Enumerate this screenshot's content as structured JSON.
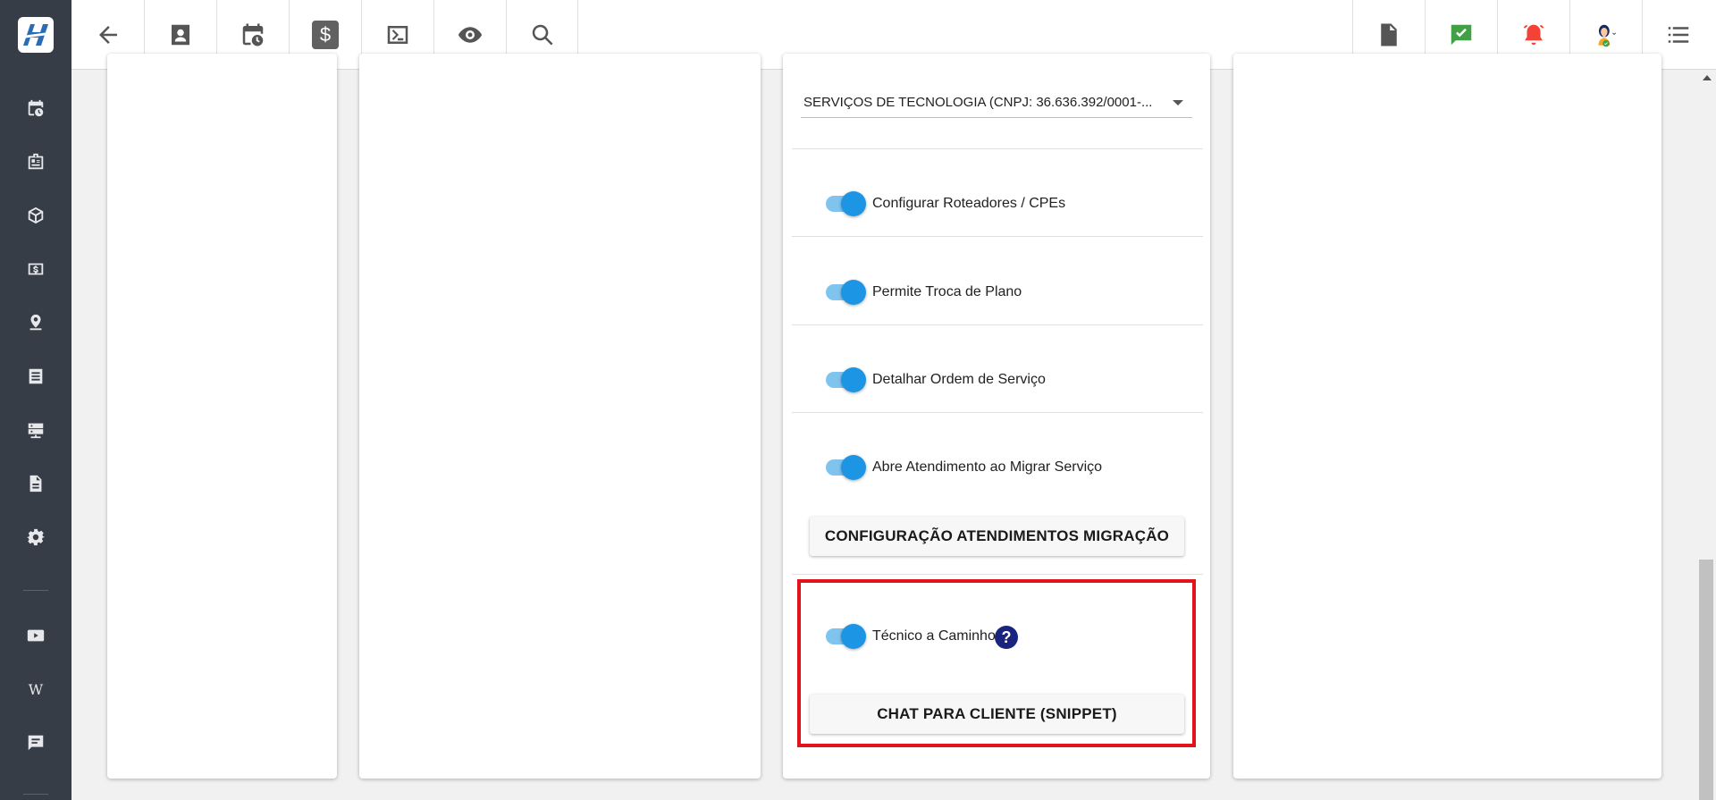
{
  "topbar": {
    "buttons": [
      {
        "name": "back-button",
        "icon": "arrow-left-icon"
      },
      {
        "name": "client-button",
        "icon": "contact-card-icon"
      },
      {
        "name": "schedule-button",
        "icon": "calendar-clock-icon"
      },
      {
        "name": "finance-button",
        "icon": "dollar-icon",
        "glyph": "$"
      },
      {
        "name": "terminal-button",
        "icon": "terminal-icon"
      },
      {
        "name": "view-button",
        "icon": "eye-icon"
      },
      {
        "name": "search-button",
        "icon": "search-icon"
      }
    ],
    "right_buttons": [
      {
        "name": "pdf-button",
        "icon": "pdf-icon"
      },
      {
        "name": "messages-button",
        "icon": "chat-check-icon",
        "color": "#43a047"
      },
      {
        "name": "alerts-button",
        "icon": "alarm-bell-icon",
        "color": "#f44336"
      },
      {
        "name": "user-menu",
        "icon": "avatar-icon"
      },
      {
        "name": "menu-button",
        "icon": "list-icon"
      }
    ]
  },
  "sidebar": {
    "items": [
      {
        "name": "sidebar-item-schedule",
        "icon": "calendar-clock-icon"
      },
      {
        "name": "sidebar-item-company",
        "icon": "building-icon"
      },
      {
        "name": "sidebar-item-products",
        "icon": "box-icon"
      },
      {
        "name": "sidebar-item-finance",
        "icon": "dollar-box-icon"
      },
      {
        "name": "sidebar-item-location",
        "icon": "map-pin-icon"
      },
      {
        "name": "sidebar-item-list",
        "icon": "list-box-icon"
      },
      {
        "name": "sidebar-item-servers",
        "icon": "server-icon"
      },
      {
        "name": "sidebar-item-documents",
        "icon": "document-icon"
      },
      {
        "name": "sidebar-item-settings",
        "icon": "gear-icon"
      },
      {
        "name": "sidebar-item-videos",
        "icon": "video-play-icon"
      },
      {
        "name": "sidebar-item-wiki",
        "icon": "wiki-icon",
        "glyph": "W"
      },
      {
        "name": "sidebar-item-chat",
        "icon": "chat-icon"
      }
    ]
  },
  "settings": {
    "company_select": "SERVIÇOS DE TECNOLOGIA (CNPJ: 36.636.392/0001-...",
    "toggles": [
      {
        "label": "Configurar Roteadores / CPEs",
        "checked": true
      },
      {
        "label": "Permite Troca de Plano",
        "checked": true
      },
      {
        "label": "Detalhar Ordem de Serviço",
        "checked": true
      },
      {
        "label": "Abre Atendimento ao Migrar Serviço",
        "checked": true
      }
    ],
    "migration_button": "CONFIGURAÇÃO ATENDIMENTOS MIGRAÇÃO",
    "technician_toggle": {
      "label": "Técnico a Caminho",
      "checked": true,
      "help": "?"
    },
    "chat_button": "CHAT PARA CLIENTE (SNIPPET)"
  },
  "colors": {
    "sidebar_bg": "#363d47",
    "toggle_on": "#1c95e5",
    "highlight_border": "#e1141b",
    "help_bg": "#1a237e"
  }
}
